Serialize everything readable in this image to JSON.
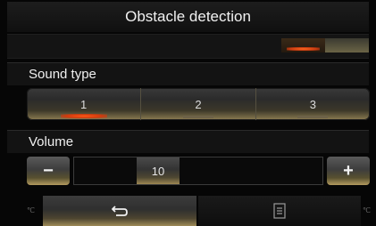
{
  "header": {
    "title": "Obstacle detection"
  },
  "toggle": {
    "state": "on"
  },
  "sound_type": {
    "label": "Sound type",
    "options": [
      "1",
      "2",
      "3"
    ],
    "selected": "1"
  },
  "volume": {
    "label": "Volume",
    "minus_label": "−",
    "plus_label": "+",
    "value": "10"
  },
  "footer": {
    "back_icon": "back-arrow-icon",
    "menu_icon": "menu-list-icon",
    "corner_left": "℃",
    "corner_right": "℃"
  },
  "colors": {
    "accent": "#ff5a18",
    "gold": "#b39a5e"
  }
}
